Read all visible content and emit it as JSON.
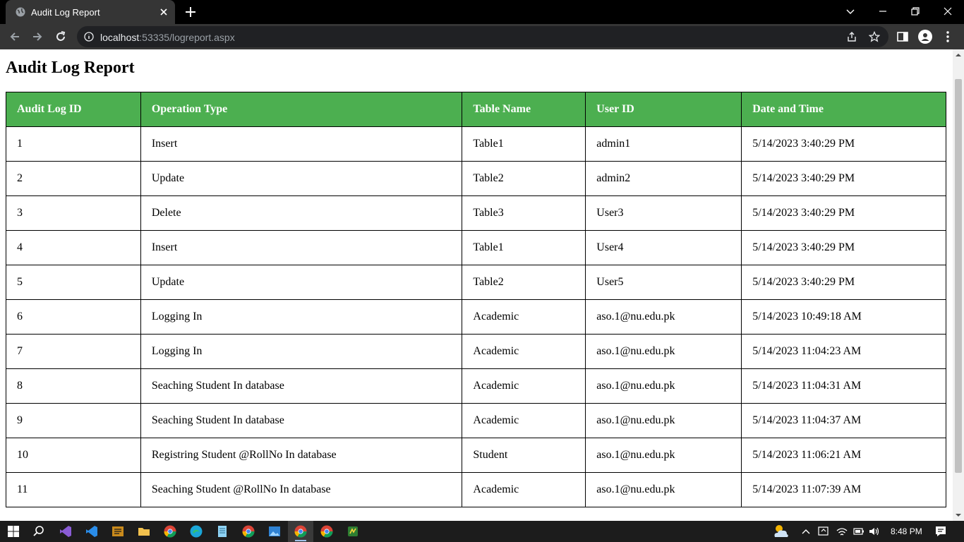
{
  "browser": {
    "tab_title": "Audit Log Report",
    "url_host": "localhost",
    "url_rest": ":53335/logreport.aspx"
  },
  "page": {
    "title": "Audit Log Report",
    "table": {
      "headers": [
        "Audit Log ID",
        "Operation Type",
        "Table Name",
        "User ID",
        "Date and Time"
      ],
      "rows": [
        [
          "1",
          "Insert",
          "Table1",
          "admin1",
          "5/14/2023 3:40:29 PM"
        ],
        [
          "2",
          "Update",
          "Table2",
          "admin2",
          "5/14/2023 3:40:29 PM"
        ],
        [
          "3",
          "Delete",
          "Table3",
          "User3",
          "5/14/2023 3:40:29 PM"
        ],
        [
          "4",
          "Insert",
          "Table1",
          "User4",
          "5/14/2023 3:40:29 PM"
        ],
        [
          "5",
          "Update",
          "Table2",
          "User5",
          "5/14/2023 3:40:29 PM"
        ],
        [
          "6",
          "Logging In",
          "Academic",
          "aso.1@nu.edu.pk",
          "5/14/2023 10:49:18 AM"
        ],
        [
          "7",
          "Logging In",
          "Academic",
          "aso.1@nu.edu.pk",
          "5/14/2023 11:04:23 AM"
        ],
        [
          "8",
          "Seaching Student In database",
          "Academic",
          "aso.1@nu.edu.pk",
          "5/14/2023 11:04:31 AM"
        ],
        [
          "9",
          "Seaching Student In database",
          "Academic",
          "aso.1@nu.edu.pk",
          "5/14/2023 11:04:37 AM"
        ],
        [
          "10",
          "Registring Student @RollNo In database",
          "Student",
          "aso.1@nu.edu.pk",
          "5/14/2023 11:06:21 AM"
        ],
        [
          "11",
          "Seaching Student @RollNo In database",
          "Academic",
          "aso.1@nu.edu.pk",
          "5/14/2023 11:07:39 AM"
        ]
      ]
    }
  },
  "taskbar": {
    "clock": "8:48 PM",
    "icons": [
      "windows-start-icon",
      "search-icon",
      "visual-studio-icon",
      "vscode-icon",
      "sql-icon",
      "file-explorer-icon",
      "chrome-icon",
      "edge-icon",
      "notepad-icon",
      "chrome-icon",
      "photos-icon",
      "chrome-icon",
      "chrome-icon",
      "python-icon"
    ]
  },
  "colors": {
    "header_bg": "#4caf50",
    "header_text": "#ffffff",
    "tabbar_bg": "#000000",
    "toolbar_bg": "#353535",
    "taskbar_bg": "#1c1c1c"
  }
}
